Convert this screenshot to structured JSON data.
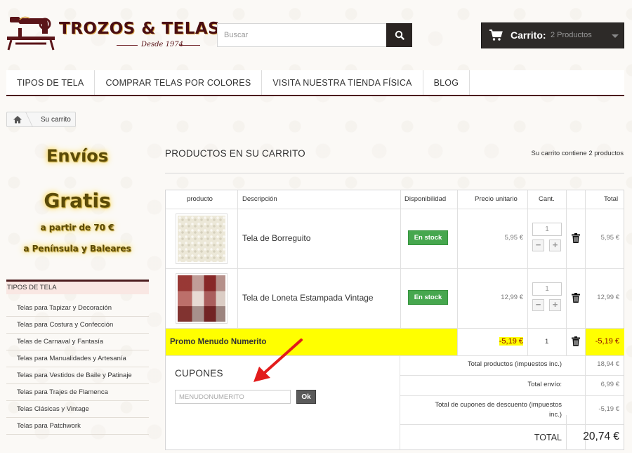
{
  "header": {
    "logo_text": "TROZOS & TELAS",
    "logo_tagline": "Desde 1974",
    "search_placeholder": "Buscar",
    "cart_label": "Carrito:",
    "cart_count": "2 Productos"
  },
  "nav": [
    "TIPOS DE TELA",
    "COMPRAR TELAS POR COLORES",
    "VISITA NUESTRA TIENDA FÍSICA",
    "BLOG"
  ],
  "breadcrumb": {
    "current": "Su carrito"
  },
  "promo": {
    "line1": "Envíos",
    "line2": "Gratis",
    "line3": "a partir de 70 €",
    "line4": "a Península y Baleares"
  },
  "categories": {
    "title": "TIPOS DE TELA",
    "items": [
      "Telas para Tapizar y Decoración",
      "Telas para Costura y Confección",
      "Telas de Carnaval y Fantasía",
      "Telas para Manualidades y Artesanía",
      "Telas para Vestidos de Baile y Patinaje",
      "Telas para Trajes de Flamenca",
      "Telas Clásicas y Vintage",
      "Telas para Patchwork"
    ]
  },
  "cart": {
    "heading": "PRODUCTOS EN SU CARRITO",
    "summary": "Su carrito contiene 2 productos",
    "columns": {
      "product": "producto",
      "description": "Descripción",
      "availability": "Disponibilidad",
      "unit_price": "Precio unitario",
      "qty": "Cant.",
      "total": "Total"
    },
    "rows": [
      {
        "name": "Tela de Borreguito",
        "stock": "En stock",
        "unit_price": "5,95 €",
        "qty": "1",
        "total": "5,95 €"
      },
      {
        "name": "Tela de Loneta Estampada Vintage",
        "stock": "En stock",
        "unit_price": "12,99 €",
        "qty": "1",
        "total": "12,99 €"
      }
    ],
    "discount": {
      "name": "Promo Menudo Numerito",
      "value": "-5,19 €",
      "qty": "1",
      "total": "-5,19 €"
    },
    "totals": {
      "products_label": "Total productos (impuestos inc.)",
      "products_value": "18,94 €",
      "shipping_label": "Total envío:",
      "shipping_value": "6,99 €",
      "coupons_label_1": "Total de cupones de descuento (impuestos",
      "coupons_label_2": "inc.)",
      "coupons_value": "-5,19 €",
      "grand_label": "TOTAL",
      "grand_value": "20,74 €"
    },
    "coupon": {
      "title": "CUPONES",
      "input_value": "MENUDONUMERITO",
      "button": "Ok"
    }
  },
  "colors": {
    "brand": "#4c1c1e",
    "stock_green": "#46a74e",
    "highlight": "#ffff00",
    "arrow": "#e21b1b"
  }
}
